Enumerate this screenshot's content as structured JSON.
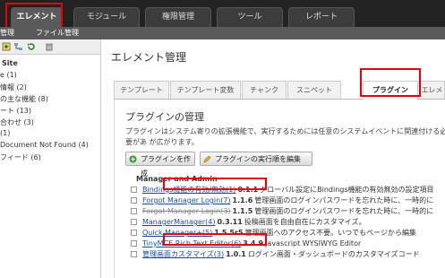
{
  "topnav": {
    "tabs": [
      {
        "label": "エレメント",
        "active": true
      },
      {
        "label": "モジュール",
        "active": false
      },
      {
        "label": "権限管理",
        "active": false
      },
      {
        "label": "ツール",
        "active": false
      },
      {
        "label": "レポート",
        "active": false
      }
    ]
  },
  "subnav": {
    "left_label": "管理",
    "item": "ファイル管理"
  },
  "sidebar": {
    "icons": [
      "add-icon",
      "tree-icon",
      "refresh-icon",
      "trash-icon"
    ],
    "items": [
      {
        "label": "Site"
      },
      {
        "label": "e (1)"
      },
      {
        "label": "情報 (2)"
      },
      {
        "label": "の主な機能 (8)"
      },
      {
        "label": "ート (13)"
      },
      {
        "label": "合わせ (3)"
      },
      {
        "label": "(1)"
      },
      {
        "label": "Document Not Found (4)"
      },
      {
        "label": "フィード (6)"
      }
    ]
  },
  "main": {
    "title": "エレメント管理",
    "tabs": [
      {
        "label": "テンプレート",
        "active": false
      },
      {
        "label": "テンプレート変数",
        "active": false
      },
      {
        "label": "チャンク",
        "active": false
      },
      {
        "label": "スニペット",
        "active": false
      },
      {
        "label": "プラグイン",
        "active": true
      },
      {
        "label": "エレメ",
        "active": false
      }
    ],
    "section_title": "プラグインの管理",
    "description": "プラグインはシステム寄りの拡張機能で、実行するためには任意のシステムイベントに関連付ける必要があ が広がります。",
    "buttons": {
      "create": "プラグインを作成",
      "order": "プラグインの実行順を編集"
    },
    "group_header": "Manager and Admin",
    "plugins": [
      {
        "name": "Bindings機能の有効/無効(1)",
        "version": "0.1.1",
        "desc": "グローバル設定にBindings機能の有効無効の設定項目",
        "disabled": false
      },
      {
        "name": "Forgot Manager Login(7)",
        "version": "1.1.6",
        "desc": "管理画面のログインパスワードを忘れた時に、一時的に",
        "disabled": false
      },
      {
        "name": "Forgot Manager Login(3)",
        "version": "1.1.5",
        "desc": "管理画面のログインパスワードを忘れた時に、一時的に",
        "disabled": true
      },
      {
        "name": "ManagerManager(4)",
        "version": "0.3.11",
        "desc": "投稿画面を自由自在にカスタマイズ。",
        "disabled": false
      },
      {
        "name": "Quick Manager+(5)",
        "version": "1.5.5r5",
        "desc": "管理画面へのアクセス不要。いつでもページから編集",
        "disabled": false
      },
      {
        "name": "TinyMCE Rich Text Editor(6)",
        "version": "3.4.9",
        "desc": "Javascript WYSIWYG Editor",
        "disabled": false
      },
      {
        "name": "管理画面カスタマイズ(3)",
        "version": "1.0.1",
        "desc": "ログイン画面・ダッシュボードのカスタマイズコード",
        "disabled": false
      }
    ]
  },
  "colors": {
    "highlight": "#e60012",
    "link": "#1a4d9c",
    "topbar": "#222222"
  }
}
